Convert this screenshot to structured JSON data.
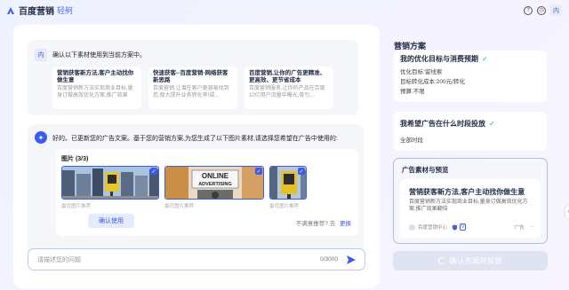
{
  "header": {
    "brand": "百度营销",
    "brand_sub": "轻舸",
    "help_icon": "help-icon",
    "clock_icon": "clock-icon",
    "avatar": "内"
  },
  "chat": {
    "user_avatar": "内",
    "user_message": "确认以下素材使用到当前方案中。",
    "options": [
      {
        "title": "营销获客新方法,客户主动找你做生意",
        "desc": "百度营销新方法实现商业目标,量身订做高效优化方案,推广效果"
      },
      {
        "title": "快速获客--百度营销-网络获客新思路",
        "desc": "百度营销,让潜在客户更容易找到您,极大提升业务转化率!成..."
      },
      {
        "title": "百度营销,让你的广告更精准、更高效、更节省成本",
        "desc": "百度营销服务,让你的产品在百度10亿用户流量中曝光,吸引..."
      }
    ],
    "bot_message": "好的。已更新您的广告文案。基于您的营销方案,为您生成了以下图片素材,请选择您希望在广告中使用的:",
    "images_title": "图片 (3/3)",
    "asset_captions": [
      "最优图片推荐",
      "最优图片推荐",
      "最优图片推荐"
    ],
    "billboard_text_1": "ONLINE",
    "billboard_text_2": "ADVERTISING",
    "confirm_use": "确认使用",
    "not_satisfied": "不满意推荐?",
    "go": "去",
    "change": "更换",
    "input_placeholder": "请描述您的问题",
    "counter": "0/3000"
  },
  "panel": {
    "title": "营销方案",
    "goal_title": "我的优化目标与消费预期",
    "goal_items": [
      "优化目标:留线索",
      "目标转化成本:200元/转化",
      "预算:不限"
    ],
    "schedule_title": "我希望广告在什么时段投放",
    "schedule_value": "全部时段",
    "preview_title": "广告素材与预览",
    "ad_headline": "营销获客新方法,客户主动找你做生意",
    "ad_desc": "百度营销新方法实现商业目标,量身订做高效优化方案,推广效果翻倍",
    "ad_source": "百度营销中心",
    "ad_tag": "V",
    "ad_label": "广告",
    "confirm_plan": "确认方案并投放",
    "colors": {
      "accent": "#3b5cf0",
      "success": "#20b26b"
    }
  }
}
